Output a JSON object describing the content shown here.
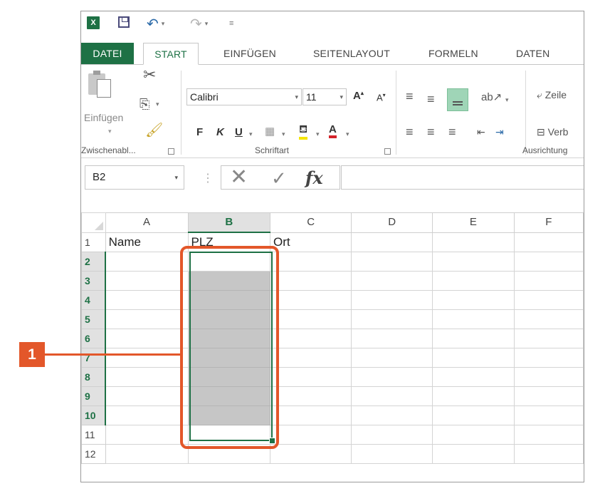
{
  "qat": {
    "excel_logo": "X",
    "undo_caret": "▾",
    "redo_caret": "▾",
    "customize": "≡"
  },
  "tabs": [
    "DATEI",
    "START",
    "EINFÜGEN",
    "SEITENLAYOUT",
    "FORMELN",
    "DATEN"
  ],
  "ribbon": {
    "paste_label": "Einfügen",
    "clipboard_group": "Zwischenabl...",
    "font_group": "Schriftart",
    "alignment_group": "Ausrichtung",
    "font_name": "Calibri",
    "font_size": "11",
    "bold": "F",
    "italic": "K",
    "underline": "U",
    "wrap_text": "Zeile",
    "merge": "Verb"
  },
  "formula_bar": {
    "name_box": "B2",
    "formula": ""
  },
  "sheet": {
    "columns": [
      "A",
      "B",
      "C",
      "D",
      "E",
      "F"
    ],
    "selected_column": "B",
    "rows": [
      {
        "n": "1",
        "cells": [
          "Name",
          "PLZ",
          "Ort",
          "",
          "",
          ""
        ]
      },
      {
        "n": "2",
        "cells": [
          "",
          "",
          "",
          "",
          "",
          ""
        ]
      },
      {
        "n": "3",
        "cells": [
          "",
          "",
          "",
          "",
          "",
          ""
        ]
      },
      {
        "n": "4",
        "cells": [
          "",
          "",
          "",
          "",
          "",
          ""
        ]
      },
      {
        "n": "5",
        "cells": [
          "",
          "",
          "",
          "",
          "",
          ""
        ]
      },
      {
        "n": "6",
        "cells": [
          "",
          "",
          "",
          "",
          "",
          ""
        ]
      },
      {
        "n": "7",
        "cells": [
          "",
          "",
          "",
          "",
          "",
          ""
        ]
      },
      {
        "n": "8",
        "cells": [
          "",
          "",
          "",
          "",
          "",
          ""
        ]
      },
      {
        "n": "9",
        "cells": [
          "",
          "",
          "",
          "",
          "",
          ""
        ]
      },
      {
        "n": "10",
        "cells": [
          "",
          "",
          "",
          "",
          "",
          ""
        ]
      },
      {
        "n": "11",
        "cells": [
          "",
          "",
          "",
          "",
          "",
          ""
        ]
      },
      {
        "n": "12",
        "cells": [
          "",
          "",
          "",
          "",
          "",
          ""
        ]
      }
    ],
    "selected_rows": [
      "2",
      "3",
      "4",
      "5",
      "6",
      "7",
      "8",
      "9",
      "10"
    ]
  },
  "callout": {
    "number": "1"
  },
  "colors": {
    "excel_green": "#1e7145",
    "callout_orange": "#e3572a",
    "selection_gray": "#c6c6c6"
  }
}
